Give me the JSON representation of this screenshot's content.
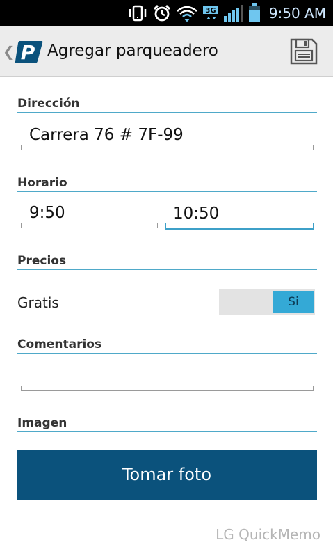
{
  "status_bar": {
    "time": "9:50 AM",
    "network_label": "3G",
    "icons": [
      "vibrate-icon",
      "alarm-icon",
      "wifi-icon",
      "network-3g-icon",
      "signal-icon",
      "battery-icon"
    ]
  },
  "action_bar": {
    "title": "Agregar parqueadero",
    "back_glyph": "❮",
    "logo_letter": "P",
    "save_icon": "save-icon"
  },
  "form": {
    "address": {
      "label": "Dirección",
      "value": "Carrera 76 # 7F-99"
    },
    "schedule": {
      "label": "Horario",
      "start": "9:50",
      "end": "10:50"
    },
    "prices": {
      "label": "Precios",
      "free_label": "Gratis",
      "free_toggle": "Si"
    },
    "comments": {
      "label": "Comentarios",
      "value": ""
    },
    "image": {
      "label": "Imagen",
      "button": "Tomar foto"
    }
  },
  "watermark": "LG QuickMemo",
  "colors": {
    "accent": "#4fa9c9",
    "button": "#0b527c",
    "toggle_on": "#34a9d6",
    "action_bar": "#ececec"
  }
}
